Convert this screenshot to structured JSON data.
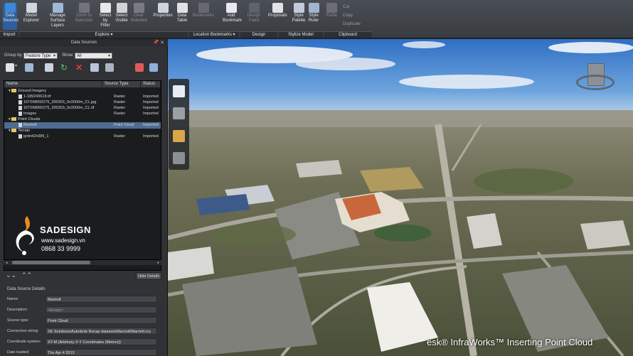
{
  "ribbon": {
    "buttons": [
      {
        "label": "Data\nSources",
        "state": "active"
      },
      {
        "label": "Model\nExplorer",
        "state": "normal"
      },
      {
        "label": "Manage\nSurface Layers",
        "state": "normal"
      },
      {
        "label": "Zoom to\nSelection",
        "state": "disabled"
      },
      {
        "label": "Select by\nFilter",
        "state": "normal"
      },
      {
        "label": "Select\nVisible",
        "state": "normal"
      },
      {
        "label": "Clear\nSelected",
        "state": "disabled"
      },
      {
        "label": "Properties",
        "state": "normal"
      },
      {
        "label": "Data\nTable",
        "state": "normal"
      },
      {
        "label": "Bookmarks",
        "state": "disabled"
      },
      {
        "label": "Add\nBookmark",
        "state": "normal"
      },
      {
        "label": "Design Feed",
        "state": "disabled"
      },
      {
        "label": "Proposals",
        "state": "normal"
      },
      {
        "label": "Style\nPalette",
        "state": "normal"
      },
      {
        "label": "Style\nRuler",
        "state": "normal"
      },
      {
        "label": "Paste",
        "state": "disabled"
      }
    ],
    "clipboard_small": [
      "Cut",
      "Copy",
      "Duplicate"
    ],
    "groups": [
      "Import",
      "Explore ▾",
      "Location Bookmarks ▾",
      "Design",
      "Stylize Model",
      "Clipboard"
    ]
  },
  "panel": {
    "title": "Data Sources",
    "group_by_label": "Group by:",
    "group_by_value": "Feature Type",
    "show_label": "Show:",
    "show_value": "All",
    "columns": [
      "Name",
      "Source Type",
      "Status"
    ],
    "rows": [
      {
        "name": "Ground Imagery",
        "type": "",
        "status": "",
        "kind": "folder",
        "indent": 0
      },
      {
        "name": "1-189243618.tif",
        "type": "Raster",
        "status": "Imported",
        "kind": "file",
        "indent": 1
      },
      {
        "name": "16TDM050275_200303_0x3000m_CL.jpg",
        "type": "Raster",
        "status": "Imported",
        "kind": "file",
        "indent": 1
      },
      {
        "name": "16TDM065275_200303_0x3000m_CL.tif",
        "type": "Raster",
        "status": "Imported",
        "kind": "file",
        "indent": 1
      },
      {
        "name": "Images",
        "type": "Raster",
        "status": "Imported",
        "kind": "file",
        "indent": 1
      },
      {
        "name": "Point Clouds",
        "type": "",
        "status": "",
        "kind": "folder",
        "indent": 0
      },
      {
        "name": "Marriott",
        "type": "Point Cloud",
        "status": "Imported",
        "kind": "file",
        "indent": 1,
        "selected": true
      },
      {
        "name": "Terrain",
        "type": "",
        "status": "",
        "kind": "folder",
        "indent": 0
      },
      {
        "name": "grdn42n089_1",
        "type": "Raster",
        "status": "Imported",
        "kind": "file",
        "indent": 1
      }
    ],
    "hide_details": "Hide Details",
    "details_title": "Data Source Details",
    "details": [
      {
        "label": "Name:",
        "value": "Marriott"
      },
      {
        "label": "Description:",
        "value": "<Empty>"
      },
      {
        "label": "Source type:",
        "value": "Point Cloud"
      },
      {
        "label": "Connection string:",
        "value": "SK Solutions\\Autodesk Recap datasets\\Marriott\\Marriott.rcs"
      },
      {
        "label": "Coordinate system:",
        "value": "XY-M (Arbitrary X-Y Coordinates (Meters))"
      },
      {
        "label": "Date loaded:",
        "value": "Thu Apr 4 2013"
      }
    ]
  },
  "watermark": {
    "brand": "SADESIGN",
    "site": "www.sadesign.vn",
    "phone": "0868 33 9999"
  },
  "caption": "esk® InfraWorks™ Inserting Point Cloud"
}
